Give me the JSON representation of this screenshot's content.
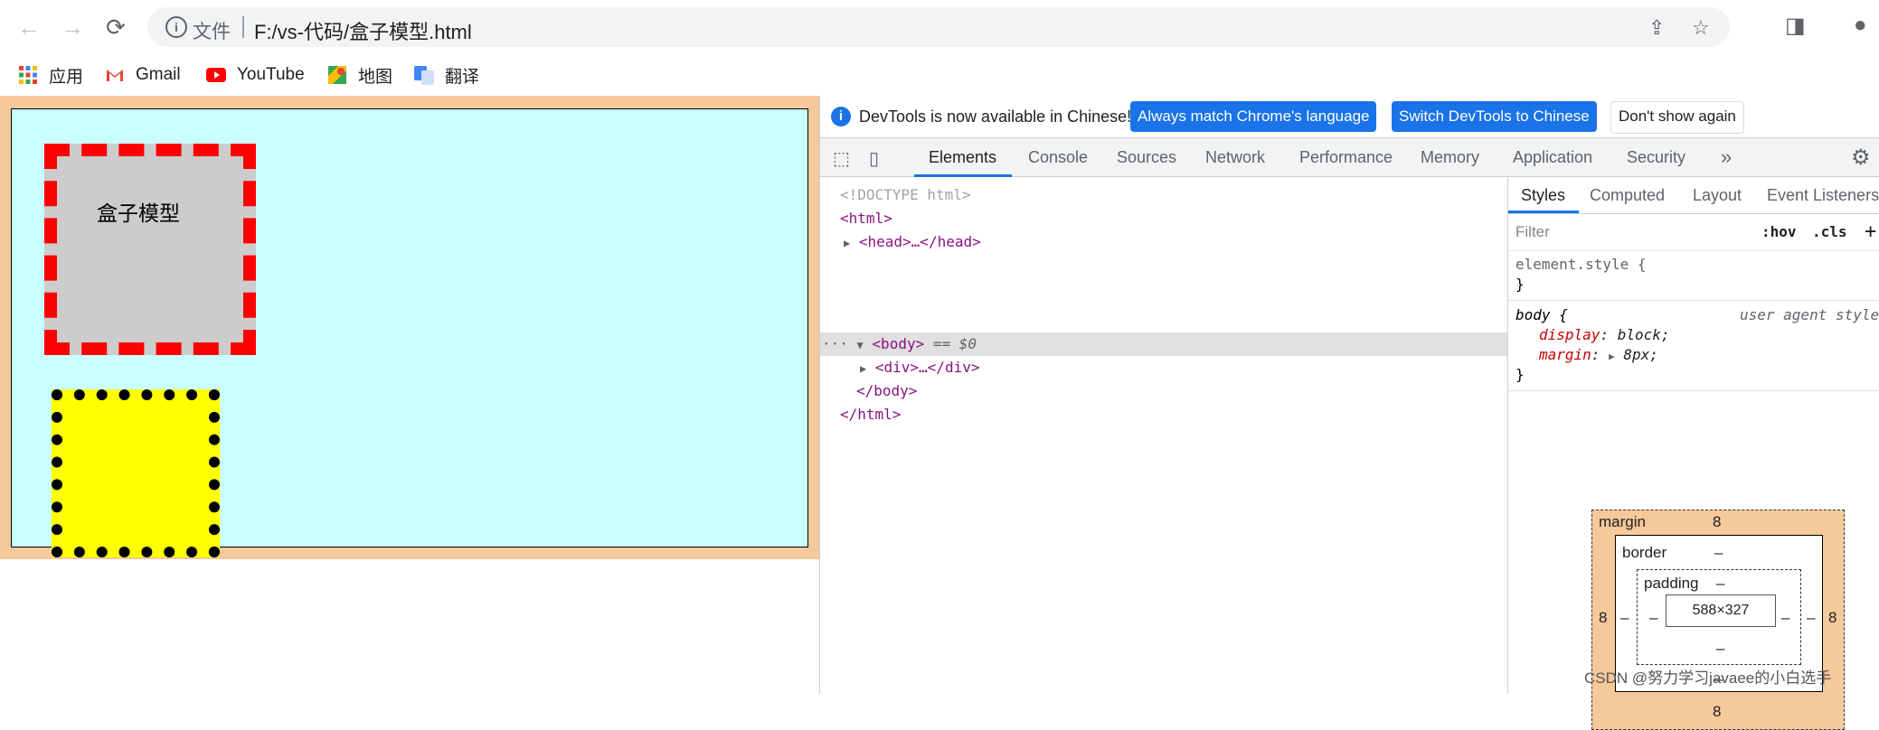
{
  "browser": {
    "nav": {
      "back": "←",
      "forward": "→",
      "reload": "⟳"
    },
    "omnibox": {
      "security_label": "文件",
      "url": "F:/vs-代码/盒子模型.html"
    },
    "bookmarks": [
      {
        "label": "应用",
        "icon": "apps-grid-icon"
      },
      {
        "label": "Gmail",
        "icon": "gmail-icon"
      },
      {
        "label": "YouTube",
        "icon": "youtube-icon"
      },
      {
        "label": "地图",
        "icon": "maps-icon"
      },
      {
        "label": "翻译",
        "icon": "translate-icon"
      }
    ]
  },
  "page": {
    "box1_text": "盒子模型",
    "colors": {
      "body_margin": "#f6c99a",
      "outer_bg": "#caffff",
      "box1_bg": "#cccccc",
      "box1_border": "#ff0000",
      "box2_bg": "#ffff00",
      "box2_border": "#000000"
    }
  },
  "devtools": {
    "notice": {
      "text": "DevTools is now available in Chinese!",
      "btn_match": "Always match Chrome's language",
      "btn_switch": "Switch DevTools to Chinese",
      "btn_dismiss": "Don't show again"
    },
    "tabs": [
      "Elements",
      "Console",
      "Sources",
      "Network",
      "Performance",
      "Memory",
      "Application",
      "Security"
    ],
    "tabs_more": "»",
    "elements_tree": {
      "doctype": "<!DOCTYPE html>",
      "html_open": "<html>",
      "head": "<head>…</head>",
      "body_open": "<body>",
      "body_eq": "== $0",
      "dots": "···",
      "div": "<div>…</div>",
      "body_close": "</body>",
      "html_close": "</html>"
    },
    "styles": {
      "tabs": [
        "Styles",
        "Computed",
        "Layout",
        "Event Listeners"
      ],
      "filter_placeholder": "Filter",
      "hov": ":hov",
      "cls": ".cls",
      "plus": "+",
      "element_style": "element.style {",
      "close_brace": "}",
      "body_selector": "body {",
      "user_agent": "user agent style",
      "display_prop": "display",
      "display_val": "block;",
      "margin_prop": "margin",
      "margin_val": "8px;"
    },
    "box_model": {
      "margin_label": "margin",
      "margin_top": "8",
      "margin_bottom": "8",
      "margin_left": "8",
      "margin_right": "8",
      "border_label": "border",
      "border_top": "–",
      "border_bottom": "–",
      "border_left": "–",
      "border_right": "–",
      "padding_label": "padding",
      "padding_top": "–",
      "padding_bottom": "–",
      "padding_left": "–",
      "padding_right": "–",
      "content": "588×327"
    }
  },
  "watermark": "CSDN @努力学习javaee的小白选手"
}
